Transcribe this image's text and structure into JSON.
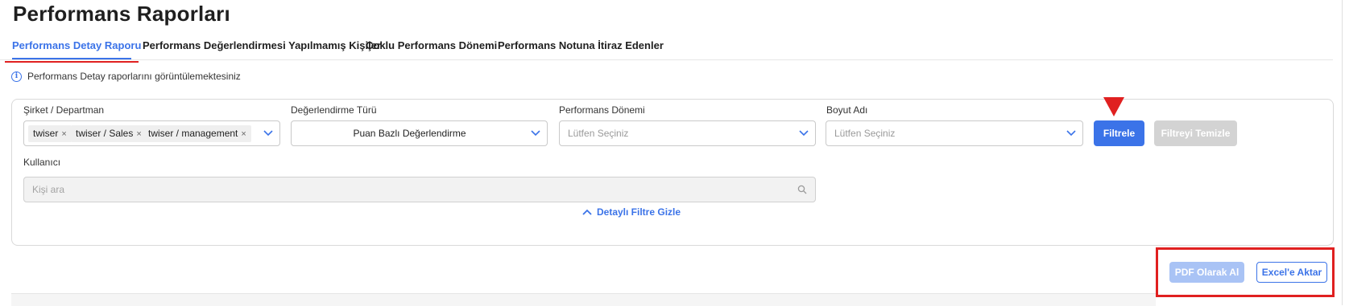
{
  "page": {
    "title": "Performans Raporları"
  },
  "tabs": [
    {
      "label": "Performans Detay Raporu",
      "active": true
    },
    {
      "label": "Performans Değerlendirmesi Yapılmamış Kişiler",
      "active": false
    },
    {
      "label": "Çoklu Performans Dönemi",
      "active": false
    },
    {
      "label": "Performans Notuna İtiraz Edenler",
      "active": false
    }
  ],
  "info": {
    "text": "Performans Detay raporlarını görüntülemektesiniz",
    "icon": "info-icon"
  },
  "filters": {
    "company": {
      "label": "Şirket / Departman",
      "chips": [
        "twiser",
        "twiser / Sales",
        "twiser / management"
      ],
      "remove_symbol": "×"
    },
    "evaluation_type": {
      "label": "Değerlendirme Türü",
      "value": "Puan Bazlı Değerlendirme"
    },
    "period": {
      "label": "Performans Dönemi",
      "placeholder": "Lütfen Seçiniz"
    },
    "dimension": {
      "label": "Boyut Adı",
      "placeholder": "Lütfen Seçiniz"
    },
    "user": {
      "label": "Kullanıcı",
      "placeholder": "Kişi ara"
    },
    "filter_button": "Filtrele",
    "clear_button": "Filtreyi Temizle",
    "toggle_link": "Detaylı Filtre Gizle"
  },
  "export": {
    "pdf_button": "PDF Olarak Al",
    "excel_button": "Excel'e Aktar"
  },
  "colors": {
    "accent": "#3b73e8",
    "annotation": "#e02020",
    "disabled": "#d3d3d3"
  }
}
